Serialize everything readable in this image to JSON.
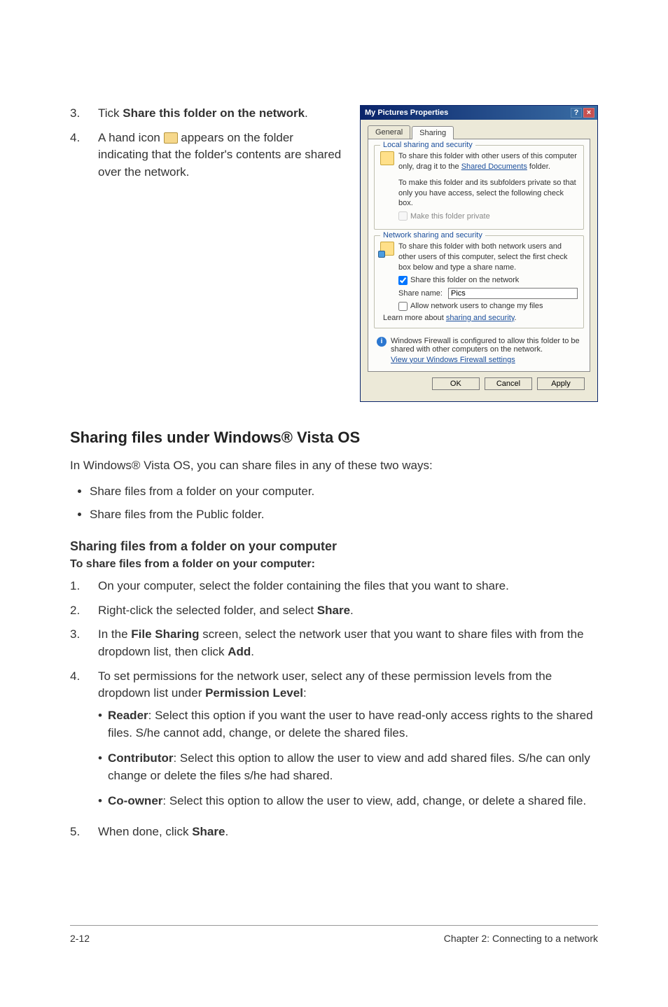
{
  "steps_top": [
    {
      "num": "3.",
      "text_pre": "Tick ",
      "bold": "Share this folder on the network",
      "text_post": "."
    },
    {
      "num": "4.",
      "text": "A hand icon  appears on the folder indicating that the folder's contents are shared over the network."
    }
  ],
  "dialog": {
    "title": "My Pictures Properties",
    "tabs": {
      "general": "General",
      "sharing": "Sharing"
    },
    "local_group": {
      "legend": "Local sharing and security",
      "line1_pre": "To share this folder with other users of this computer only, drag it to the ",
      "line1_link": "Shared Documents",
      "line1_post": " folder.",
      "line2": "To make this folder and its subfolders private so that only you have access, select the following check box.",
      "cb_private": "Make this folder private"
    },
    "net_group": {
      "legend": "Network sharing and security",
      "line1": "To share this folder with both network users and other users of this computer, select the first check box below and type a share name.",
      "cb_share": "Share this folder on the network",
      "share_label": "Share name:",
      "share_value": "Pics",
      "cb_change": "Allow network users to change my files",
      "learn": "Learn more about ",
      "learn_link": "sharing and security",
      "learn_post": "."
    },
    "info_text": "Windows Firewall is configured to allow this folder to be shared with other computers on the network.",
    "info_link": "View your Windows Firewall settings",
    "buttons": {
      "ok": "OK",
      "cancel": "Cancel",
      "apply": "Apply"
    }
  },
  "vista": {
    "heading": "Sharing files under Windows® Vista OS",
    "intro": "In Windows® Vista OS, you can share files in any of these two ways:",
    "bullets": [
      "Share files from a folder on your computer.",
      "Share files from the Public folder."
    ],
    "sub_heading": "Sharing files from a folder on your computer",
    "sub_heading2": "To share files from a folder on your computer:",
    "steps": [
      {
        "num": "1.",
        "text": "On your computer, select the folder containing the files that you want to share."
      },
      {
        "num": "2.",
        "pre": "Right-click the selected folder, and select ",
        "b1": "Share",
        "post": "."
      },
      {
        "num": "3.",
        "pre": "In the ",
        "b1": "File Sharing",
        "mid": " screen, select the network user that you want to share files with from the dropdown list, then click ",
        "b2": "Add",
        "post": "."
      },
      {
        "num": "4.",
        "pre": "To set permissions for the network user, select any of these permission levels from the dropdown list under ",
        "b1": "Permission Level",
        "post": ":",
        "sub": [
          {
            "b": "Reader",
            "t": ": Select this option if you want the user to have read-only access rights to the shared files. S/he cannot add, change, or delete the shared files."
          },
          {
            "b": "Contributor",
            "t": ": Select this option to allow the user to view and add shared files. S/he can only change or delete the files s/he had shared."
          },
          {
            "b": "Co-owner",
            "t": ": Select this option to allow the user to view, add, change, or delete a shared file."
          }
        ]
      },
      {
        "num": "5.",
        "pre": "When done, click ",
        "b1": "Share",
        "post": "."
      }
    ]
  },
  "footer": {
    "left": "2-12",
    "right": "Chapter 2: Connecting to a network"
  }
}
